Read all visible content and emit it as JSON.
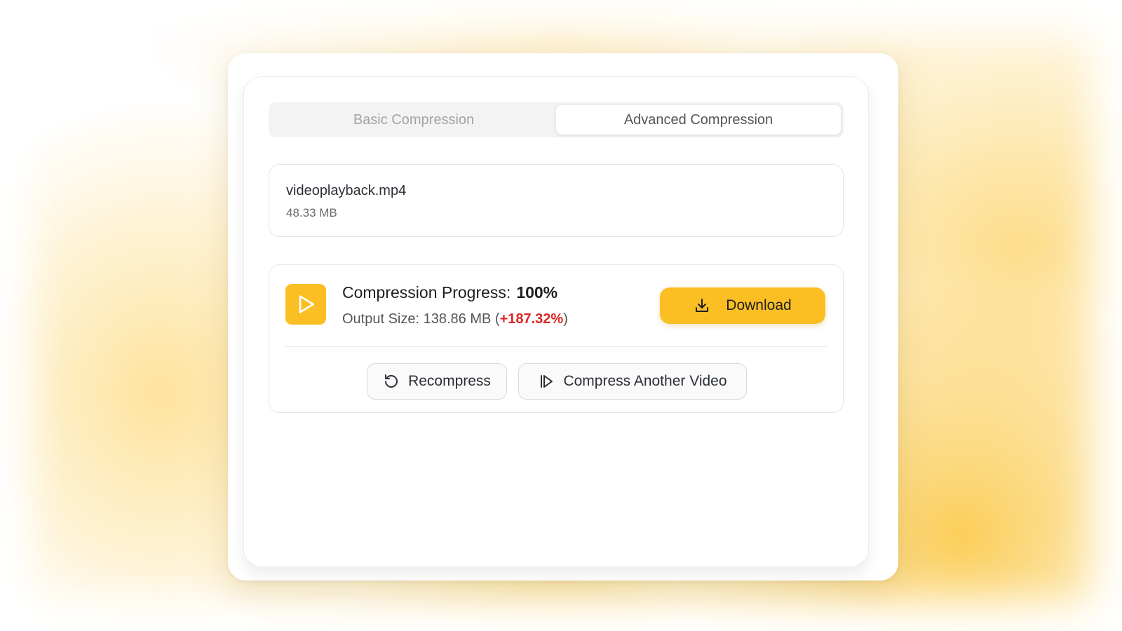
{
  "tabs": [
    {
      "label": "Basic Compression",
      "active": false
    },
    {
      "label": "Advanced Compression",
      "active": true
    }
  ],
  "file": {
    "name": "videoplayback.mp4",
    "size": "48.33 MB"
  },
  "progress": {
    "label": "Compression Progress:",
    "value": "100%",
    "output_label": "Output Size: 138.86 MB (",
    "output_change": "+187.32%",
    "output_suffix": ")"
  },
  "buttons": {
    "download": "Download",
    "recompress": "Recompress",
    "compress_another": "Compress Another Video"
  },
  "icons": {
    "video": "play-icon",
    "download": "download-icon",
    "recompress": "rotate-ccw-icon",
    "compress_another": "skip-back-play-icon"
  },
  "colors": {
    "accent": "#fbbf24",
    "negative": "#dc2626"
  }
}
